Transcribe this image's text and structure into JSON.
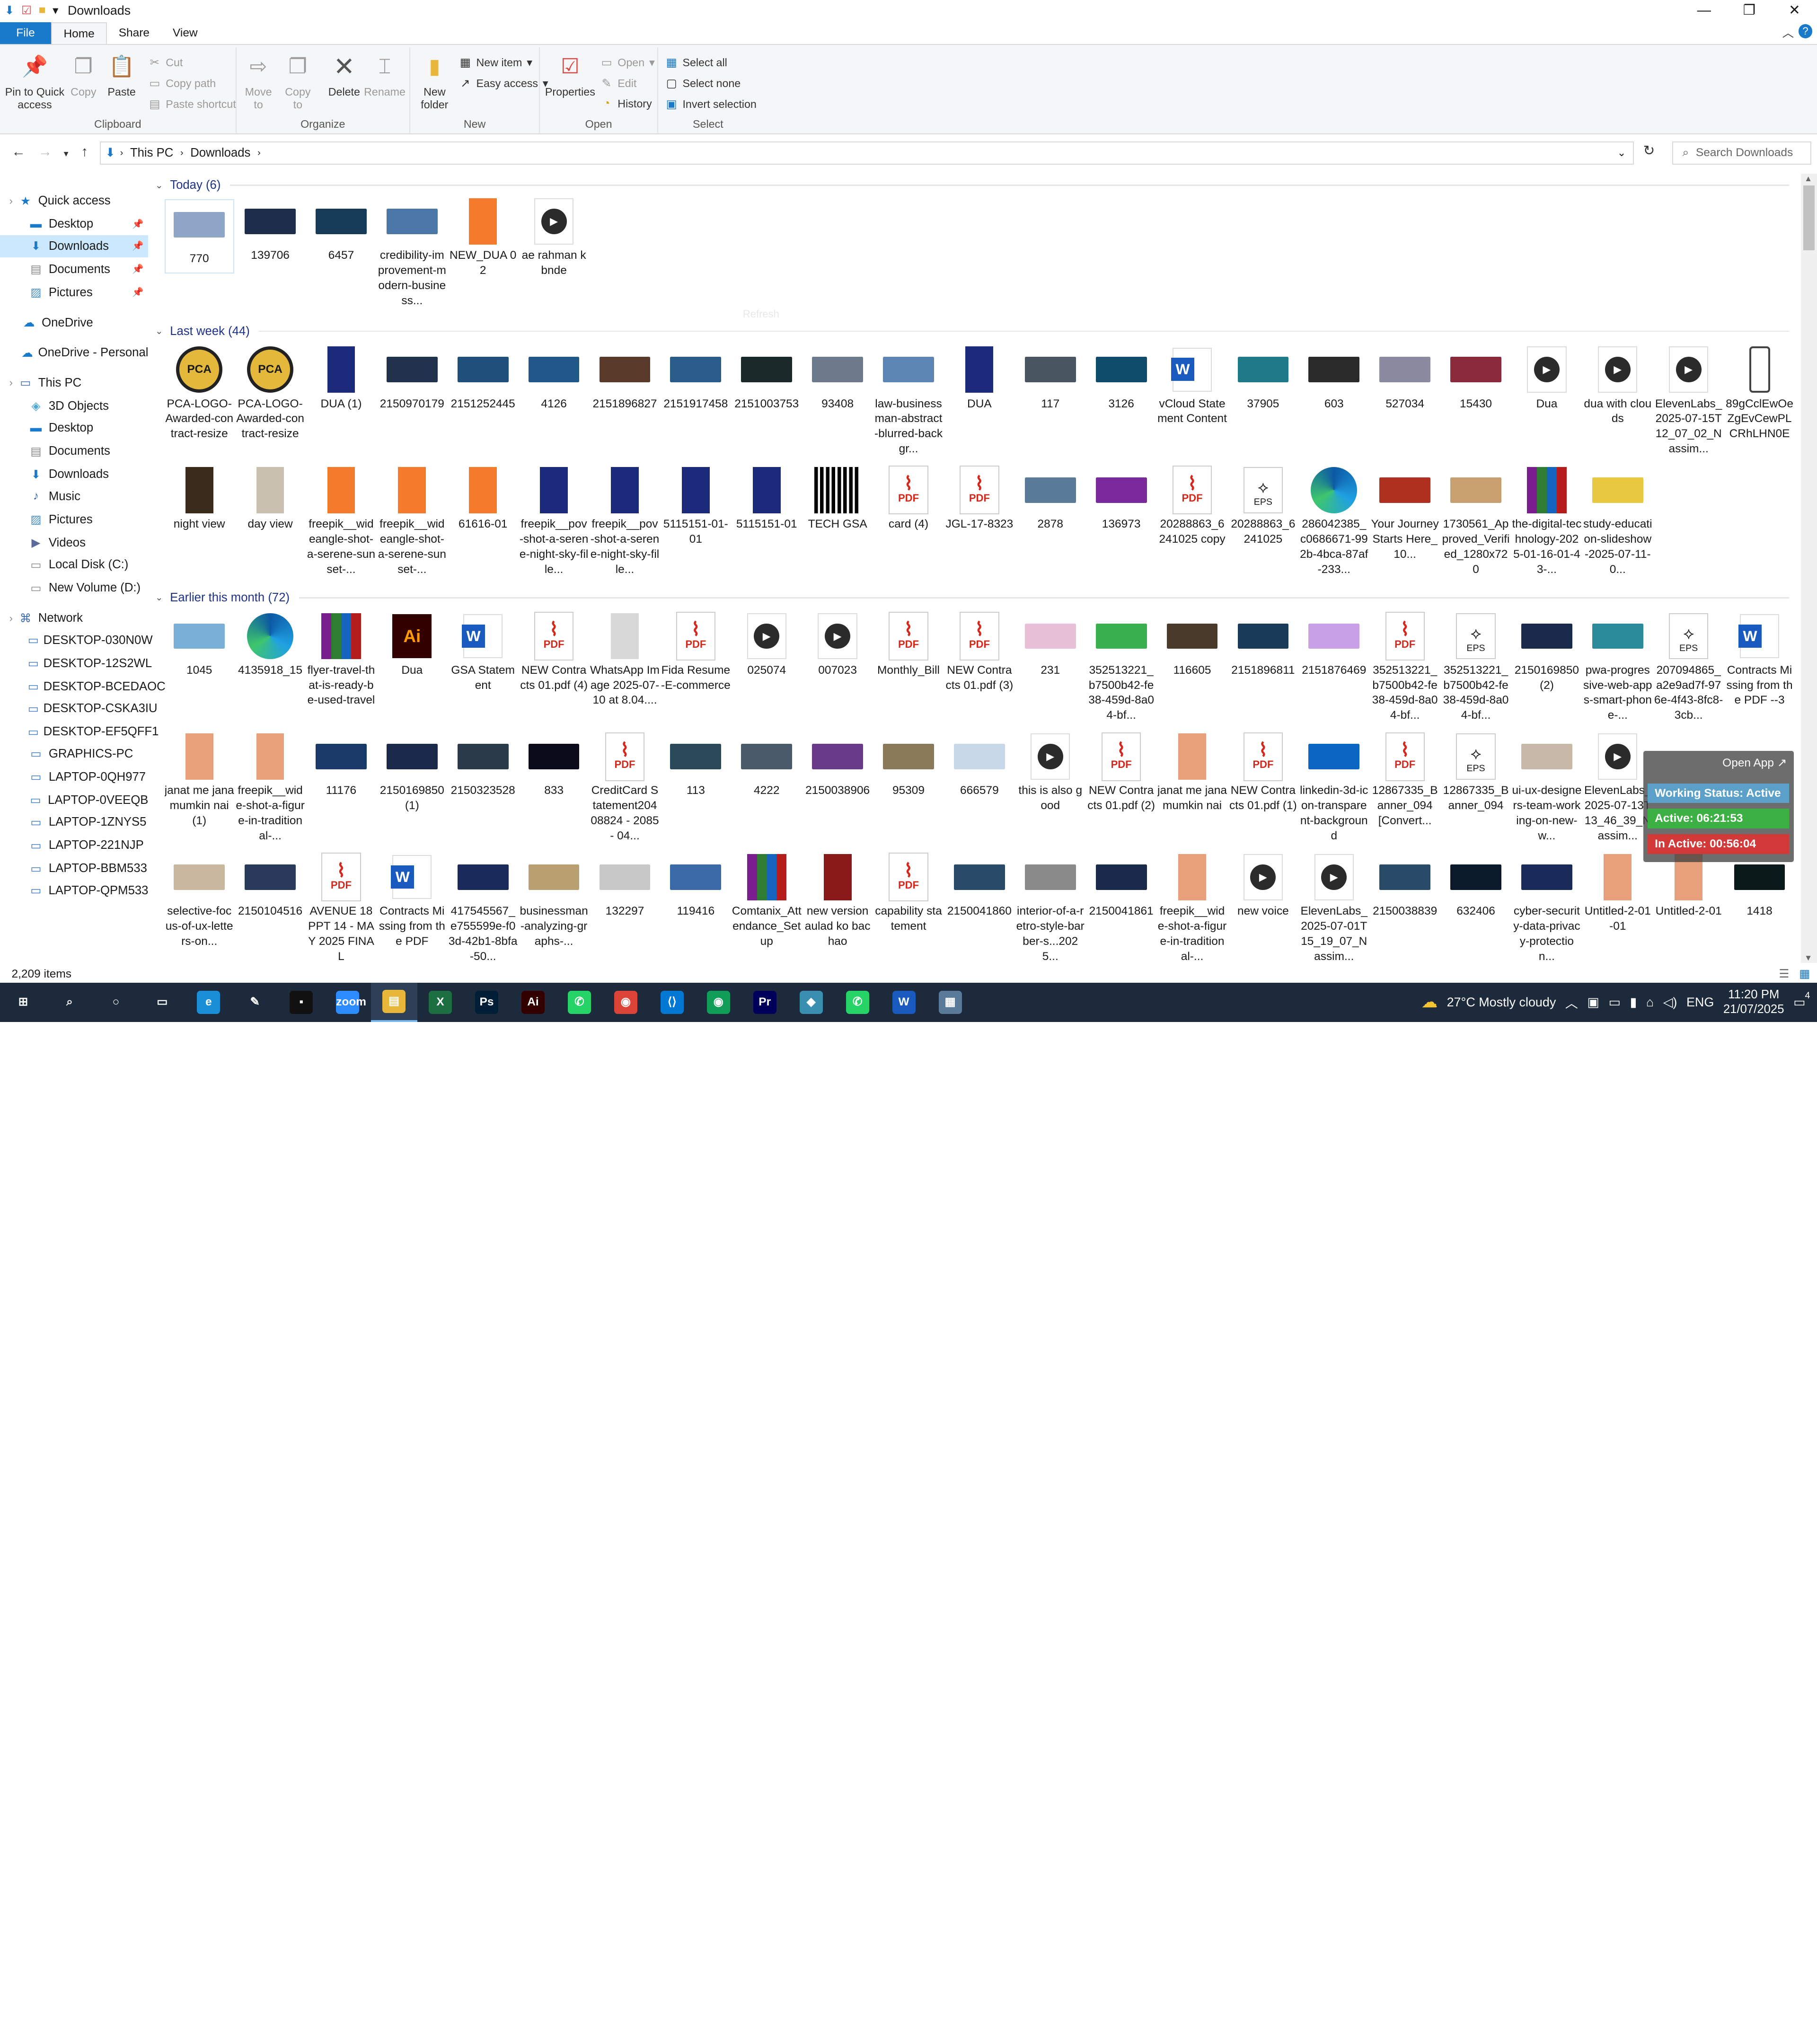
{
  "window": {
    "title": "Downloads",
    "min": "—",
    "max": "❐",
    "close": "✕"
  },
  "ribbon_tabs": [
    "File",
    "Home",
    "Share",
    "View"
  ],
  "clipboard": {
    "pin": "Pin to Quick access",
    "copy": "Copy",
    "paste": "Paste",
    "cut": "Cut",
    "copy_path": "Copy path",
    "paste_shortcut": "Paste shortcut",
    "label": "Clipboard"
  },
  "organize": {
    "move": "Move to",
    "copy": "Copy to",
    "delete": "Delete",
    "rename": "Rename",
    "label": "Organize"
  },
  "new": {
    "new_folder": "New folder",
    "new_item": "New item",
    "easy_access": "Easy access",
    "label": "New"
  },
  "open": {
    "properties": "Properties",
    "open": "Open",
    "edit": "Edit",
    "history": "History",
    "label": "Open"
  },
  "select": {
    "all": "Select all",
    "none": "Select none",
    "invert": "Invert selection",
    "label": "Select"
  },
  "address": {
    "path": [
      "This PC",
      "Downloads"
    ],
    "search_placeholder": "Search Downloads"
  },
  "sidebar": [
    {
      "label": "Quick access",
      "icon": "star-icon",
      "indent": 0,
      "pin": false
    },
    {
      "label": "Desktop",
      "icon": "desktop-icon",
      "indent": 1,
      "pin": true
    },
    {
      "label": "Downloads",
      "icon": "download-icon",
      "indent": 1,
      "pin": true,
      "selected": true
    },
    {
      "label": "Documents",
      "icon": "documents-icon",
      "indent": 1,
      "pin": true
    },
    {
      "label": "Pictures",
      "icon": "pictures-icon",
      "indent": 1,
      "pin": true
    },
    {
      "label": "OneDrive",
      "icon": "cloud-icon",
      "indent": 0
    },
    {
      "label": "OneDrive - Personal",
      "icon": "cloud-icon",
      "indent": 0
    },
    {
      "label": "This PC",
      "icon": "pc-icon",
      "indent": 0
    },
    {
      "label": "3D Objects",
      "icon": "cube-icon",
      "indent": 1
    },
    {
      "label": "Desktop",
      "icon": "desktop-icon",
      "indent": 1
    },
    {
      "label": "Documents",
      "icon": "documents-icon",
      "indent": 1
    },
    {
      "label": "Downloads",
      "icon": "download-icon",
      "indent": 1
    },
    {
      "label": "Music",
      "icon": "music-icon",
      "indent": 1
    },
    {
      "label": "Pictures",
      "icon": "pictures-icon",
      "indent": 1
    },
    {
      "label": "Videos",
      "icon": "video-icon",
      "indent": 1
    },
    {
      "label": "Local Disk (C:)",
      "icon": "drive-icon",
      "indent": 1
    },
    {
      "label": "New Volume (D:)",
      "icon": "drive-icon",
      "indent": 1
    },
    {
      "label": "Network",
      "icon": "network-icon",
      "indent": 0
    },
    {
      "label": "DESKTOP-030N0W",
      "icon": "computer-icon",
      "indent": 1
    },
    {
      "label": "DESKTOP-12S2WL",
      "icon": "computer-icon",
      "indent": 1
    },
    {
      "label": "DESKTOP-BCEDAOC",
      "icon": "computer-icon",
      "indent": 1
    },
    {
      "label": "DESKTOP-CSKA3IU",
      "icon": "computer-icon",
      "indent": 1
    },
    {
      "label": "DESKTOP-EF5QFF1",
      "icon": "computer-icon",
      "indent": 1
    },
    {
      "label": "GRAPHICS-PC",
      "icon": "computer-icon",
      "indent": 1
    },
    {
      "label": "LAPTOP-0QH977",
      "icon": "computer-icon",
      "indent": 1
    },
    {
      "label": "LAPTOP-0VEEQB",
      "icon": "computer-icon",
      "indent": 1
    },
    {
      "label": "LAPTOP-1ZNYS5",
      "icon": "computer-icon",
      "indent": 1
    },
    {
      "label": "LAPTOP-221NJP",
      "icon": "computer-icon",
      "indent": 1
    },
    {
      "label": "LAPTOP-BBM533",
      "icon": "computer-icon",
      "indent": 1
    },
    {
      "label": "LAPTOP-QPM533",
      "icon": "computer-icon",
      "indent": 1
    }
  ],
  "groups": [
    {
      "title": "Today (6)",
      "rows": [
        [
          {
            "l": "770",
            "t": "photo",
            "c": "#8fa6c8"
          },
          {
            "l": "139706",
            "t": "photo",
            "c": "#1f2d4d"
          },
          {
            "l": "6457",
            "t": "photo",
            "c": "#173c5a"
          },
          {
            "l": "credibility-improvement-modern-business...",
            "t": "photo",
            "c": "#4b78a8"
          },
          {
            "l": "NEW_DUA 02",
            "t": "port",
            "c": "#f47a2c"
          },
          {
            "l": "ae rahman k bnde",
            "t": "vid"
          }
        ]
      ]
    },
    {
      "title": "Last week (44)",
      "rows": [
        [
          {
            "l": "PCA-LOGO-Awarded-contract-resize",
            "t": "pca"
          },
          {
            "l": "PCA-LOGO-Awarded-contract-resize",
            "t": "pca"
          },
          {
            "l": "DUA  (1)",
            "t": "port",
            "c": "#1b2a7a"
          },
          {
            "l": "2150970179",
            "t": "photo",
            "c": "#20324c"
          },
          {
            "l": "2151252445",
            "t": "photo",
            "c": "#1f4f7a"
          },
          {
            "l": "4126",
            "t": "photo",
            "c": "#21588a"
          },
          {
            "l": "2151896827",
            "t": "photo",
            "c": "#5a3a2a"
          },
          {
            "l": "2151917458",
            "t": "photo",
            "c": "#2a5c8a"
          },
          {
            "l": "2151003753",
            "t": "photo",
            "c": "#1a2a2a"
          },
          {
            "l": "93408",
            "t": "photo",
            "c": "#6c7a8c"
          },
          {
            "l": "law-businessman-abstract-blurred-backgr...",
            "t": "photo",
            "c": "#5c85b3"
          },
          {
            "l": "DUA",
            "t": "port",
            "c": "#1b2a7a"
          },
          {
            "l": "117",
            "t": "photo",
            "c": "#4a5562"
          },
          {
            "l": "3126",
            "t": "photo",
            "c": "#0f4c6c"
          },
          {
            "l": "vCloud Statement Content",
            "t": "word"
          },
          {
            "l": "37905",
            "t": "photo",
            "c": "#1f7a8a"
          },
          {
            "l": "603",
            "t": "photo",
            "c": "#2a2a2a"
          },
          {
            "l": "527034",
            "t": "photo",
            "c": "#8a8aa0"
          },
          {
            "l": "15430",
            "t": "photo",
            "c": "#8a2a3a"
          },
          {
            "l": "Dua",
            "t": "vid"
          },
          {
            "l": "dua with clouds",
            "t": "vid"
          },
          {
            "l": "ElevenLabs_2025-07-15T12_07_02_Nassim...",
            "t": "vid"
          },
          {
            "l": "89gCclEwOeZgEvCewPLCRhLHN0E",
            "t": "phone"
          }
        ],
        [
          {
            "l": "night view",
            "t": "port",
            "c": "#3a2a1a"
          },
          {
            "l": "day view",
            "t": "port",
            "c": "#c9c0b0"
          },
          {
            "l": "freepik__wideangle-shot-a-serene-sunset-...",
            "t": "port",
            "c": "#f47a2c"
          },
          {
            "l": "freepik__wideangle-shot-a-serene-sunset-...",
            "t": "port",
            "c": "#f47a2c"
          },
          {
            "l": "61616-01",
            "t": "port",
            "c": "#f47a2c"
          },
          {
            "l": "freepik__pov-shot-a-serene-night-sky-fille...",
            "t": "port",
            "c": "#1b2a7a"
          },
          {
            "l": "freepik__pov-shot-a-serene-night-sky-fille...",
            "t": "port",
            "c": "#1b2a7a"
          },
          {
            "l": "5115151-01-01",
            "t": "port",
            "c": "#1b2a7a"
          },
          {
            "l": "5115151-01",
            "t": "port",
            "c": "#1b2a7a"
          },
          {
            "l": "TECH GSA",
            "t": "qr"
          },
          {
            "l": "card (4)",
            "t": "pdf"
          },
          {
            "l": "JGL-17-8323",
            "t": "pdf"
          },
          {
            "l": "2878",
            "t": "photo",
            "c": "#5a7a9a"
          },
          {
            "l": "136973",
            "t": "photo",
            "c": "#7a2a9a"
          },
          {
            "l": "20288863_6241025 copy",
            "t": "pdf"
          },
          {
            "l": "20288863_6241025",
            "t": "eps"
          },
          {
            "l": "286042385_c0686671-992b-4bca-87af-233...",
            "t": "edge"
          },
          {
            "l": "Your Journey Starts Here_10...",
            "t": "photo",
            "c": "#b03020"
          },
          {
            "l": "1730561_Approved_Verified_1280x720",
            "t": "photo",
            "c": "#c8a070"
          },
          {
            "l": "the-digital-technology-2025-01-16-01-43-...",
            "t": "zip"
          },
          {
            "l": "study-education-slideshow-2025-07-11-0...",
            "t": "photo",
            "c": "#e8c840"
          }
        ]
      ]
    },
    {
      "title": "Earlier this month (72)",
      "rows": [
        [
          {
            "l": "1045",
            "t": "photo",
            "c": "#7ab0d8"
          },
          {
            "l": "4135918_15",
            "t": "edge"
          },
          {
            "l": "flyer-travel-that-is-ready-be-used-travel",
            "t": "zip"
          },
          {
            "l": "Dua",
            "t": "ai"
          },
          {
            "l": "GSA Statement",
            "t": "word"
          },
          {
            "l": "NEW Contracts 01.pdf (4)",
            "t": "pdf"
          },
          {
            "l": "WhatsApp Image 2025-07-10 at 8.04....",
            "t": "port",
            "c": "#d8d8d8"
          },
          {
            "l": "Fida Resume-E-commerce",
            "t": "pdf"
          },
          {
            "l": "025074",
            "t": "vid"
          },
          {
            "l": "007023",
            "t": "vid"
          },
          {
            "l": "Monthly_Bill",
            "t": "pdf"
          },
          {
            "l": "NEW Contracts 01.pdf (3)",
            "t": "pdf"
          },
          {
            "l": "231",
            "t": "photo",
            "c": "#e8c0d8"
          },
          {
            "l": "352513221_b7500b42-fe38-459d-8a04-bf...",
            "t": "photo",
            "c": "#3ab050"
          },
          {
            "l": "116605",
            "t": "photo",
            "c": "#4a3a2a"
          },
          {
            "l": "2151896811",
            "t": "photo",
            "c": "#1a3a5a"
          },
          {
            "l": "2151876469",
            "t": "photo",
            "c": "#c8a0e8"
          },
          {
            "l": "352513221_b7500b42-fe38-459d-8a04-bf...",
            "t": "pdf"
          },
          {
            "l": "352513221_b7500b42-fe38-459d-8a04-bf...",
            "t": "eps"
          },
          {
            "l": "2150169850 (2)",
            "t": "photo",
            "c": "#1a2a4a"
          },
          {
            "l": "pwa-progressive-web-apps-smart-phone-...",
            "t": "photo",
            "c": "#2a8a9a"
          },
          {
            "l": "207094865_a2e9ad7f-976e-4f43-8fc8-3cb...",
            "t": "eps"
          },
          {
            "l": "Contracts Missing from the PDF --3",
            "t": "word"
          }
        ],
        [
          {
            "l": "janat me jana mumkin nai (1)",
            "t": "port",
            "c": "#e8a07a"
          },
          {
            "l": "freepik__wide-shot-a-figure-in-traditional-...",
            "t": "port",
            "c": "#e8a07a"
          },
          {
            "l": "11176",
            "t": "photo",
            "c": "#1a3a6a"
          },
          {
            "l": "2150169850 (1)",
            "t": "photo",
            "c": "#1a2a4a"
          },
          {
            "l": "2150323528",
            "t": "photo",
            "c": "#2a3a4a"
          },
          {
            "l": "833",
            "t": "photo",
            "c": "#0a0a1a"
          },
          {
            "l": "CreditCard Statement20408824 - 2085 - 04...",
            "t": "pdf"
          },
          {
            "l": "113",
            "t": "photo",
            "c": "#2a4a5a"
          },
          {
            "l": "4222",
            "t": "photo",
            "c": "#4a5a6a"
          },
          {
            "l": "2150038906",
            "t": "photo",
            "c": "#6a3a8a"
          },
          {
            "l": "95309",
            "t": "photo",
            "c": "#8a7a5a"
          },
          {
            "l": "666579",
            "t": "photo",
            "c": "#c8d8e8"
          },
          {
            "l": "this is also good",
            "t": "vid"
          },
          {
            "l": "NEW Contracts 01.pdf (2)",
            "t": "pdf"
          },
          {
            "l": "janat me jana mumkin nai",
            "t": "port",
            "c": "#e8a07a"
          },
          {
            "l": "NEW Contracts 01.pdf (1)",
            "t": "pdf"
          },
          {
            "l": "linkedin-3d-icon-transparent-background",
            "t": "photo",
            "c": "#0a66c2"
          },
          {
            "l": "12867335_Banner_094 [Convert...",
            "t": "pdf"
          },
          {
            "l": "12867335_Banner_094",
            "t": "eps"
          },
          {
            "l": "ui-ux-designers-team-working-on-new-w...",
            "t": "photo",
            "c": "#c8b8a8"
          },
          {
            "l": "ElevenLabs_2025-07-13T13_46_39_Nassim...",
            "t": "vid"
          }
        ],
        [
          {
            "l": "selective-focus-of-ux-letters-on...",
            "t": "photo",
            "c": "#c8b8a0"
          },
          {
            "l": "2150104516",
            "t": "photo",
            "c": "#2a3a5a"
          },
          {
            "l": "AVENUE 18 PPT 14 - MAY 2025 FINAL",
            "t": "pdf"
          },
          {
            "l": "Contracts Missing from the PDF",
            "t": "word"
          },
          {
            "l": "417545567_e755599e-f03d-42b1-8bfa-50...",
            "t": "photo",
            "c": "#1a2a5a"
          },
          {
            "l": "businessman-analyzing-graphs-...",
            "t": "photo",
            "c": "#b8a070"
          },
          {
            "l": "132297",
            "t": "photo",
            "c": "#c8c8c8"
          },
          {
            "l": "119416",
            "t": "photo",
            "c": "#3a6aa8"
          },
          {
            "l": "Comtanix_Attendance_Setup",
            "t": "zip"
          },
          {
            "l": "new version aulad ko bachao",
            "t": "port",
            "c": "#8a1a1a"
          },
          {
            "l": "capability statement",
            "t": "pdf"
          },
          {
            "l": "2150041860",
            "t": "photo",
            "c": "#2a4a6a"
          },
          {
            "l": "interior-of-a-retro-style-barber-s...2025...",
            "t": "photo",
            "c": "#8a8a8a"
          },
          {
            "l": "2150041861",
            "t": "photo",
            "c": "#1a2a4a"
          },
          {
            "l": "freepik__wide-shot-a-figure-in-traditional-...",
            "t": "port",
            "c": "#e8a07a"
          },
          {
            "l": "new voice",
            "t": "vid"
          },
          {
            "l": "ElevenLabs_2025-07-01T15_19_07_Nassim...",
            "t": "vid"
          },
          {
            "l": "2150038839",
            "t": "photo",
            "c": "#2a4a6a"
          },
          {
            "l": "632406",
            "t": "photo",
            "c": "#0a1a2a"
          },
          {
            "l": "cyber-security-data-privacy-protection...",
            "t": "photo",
            "c": "#1a2a5a"
          },
          {
            "l": "Untitled-2-01-01",
            "t": "port",
            "c": "#e8a07a"
          },
          {
            "l": "Untitled-2-01",
            "t": "port",
            "c": "#e8a07a"
          },
          {
            "l": "1418",
            "t": "photo",
            "c": "#0a1a1a"
          }
        ]
      ]
    }
  ],
  "refresh_hint": "Refresh",
  "status": {
    "items": "2,209 items"
  },
  "overlay": {
    "open_app": "Open App",
    "working": "Working Status: Active",
    "active": "Active: 06:21:53",
    "inactive": "In Active: 00:56:04"
  },
  "taskbar": {
    "weather": "27°C  Mostly cloudy",
    "lang": "ENG",
    "time": "11:20 PM",
    "date": "21/07/2025",
    "notif": "4"
  },
  "taskbar_apps": [
    {
      "name": "start-icon",
      "g": "⊞",
      "bg": "transparent"
    },
    {
      "name": "search-icon",
      "g": "⌕",
      "bg": "transparent"
    },
    {
      "name": "cortana-icon",
      "g": "○",
      "bg": "transparent"
    },
    {
      "name": "task-view-icon",
      "g": "▭",
      "bg": "transparent"
    },
    {
      "name": "edge-icon",
      "g": "e",
      "bg": "#1a8fd8"
    },
    {
      "name": "pen-tool-icon",
      "g": "✎",
      "bg": "transparent"
    },
    {
      "name": "terminal-icon",
      "g": "▪",
      "bg": "#111"
    },
    {
      "name": "zoom-icon",
      "g": "zoom",
      "bg": "#2d8cff"
    },
    {
      "name": "file-explorer-icon",
      "g": "▤",
      "bg": "#e8b73a"
    },
    {
      "name": "excel-icon",
      "g": "X",
      "bg": "#1d6f42"
    },
    {
      "name": "photoshop-icon",
      "g": "Ps",
      "bg": "#001e36"
    },
    {
      "name": "illustrator-icon",
      "g": "Ai",
      "bg": "#330000"
    },
    {
      "name": "whatsapp-icon",
      "g": "✆",
      "bg": "#25d366"
    },
    {
      "name": "chrome-icon",
      "g": "◉",
      "bg": "#db4437"
    },
    {
      "name": "vscode-icon",
      "g": "⟨⟩",
      "bg": "#0078d4"
    },
    {
      "name": "chrome-profile-icon",
      "g": "◉",
      "bg": "#0f9d58"
    },
    {
      "name": "premiere-icon",
      "g": "Pr",
      "bg": "#00005b"
    },
    {
      "name": "app-icon",
      "g": "◆",
      "bg": "#3a8fb0"
    },
    {
      "name": "whatsapp-business-icon",
      "g": "✆",
      "bg": "#25d366"
    },
    {
      "name": "word-icon",
      "g": "W",
      "bg": "#185abd"
    },
    {
      "name": "calculator-icon",
      "g": "▦",
      "bg": "#5a7a9a"
    }
  ]
}
